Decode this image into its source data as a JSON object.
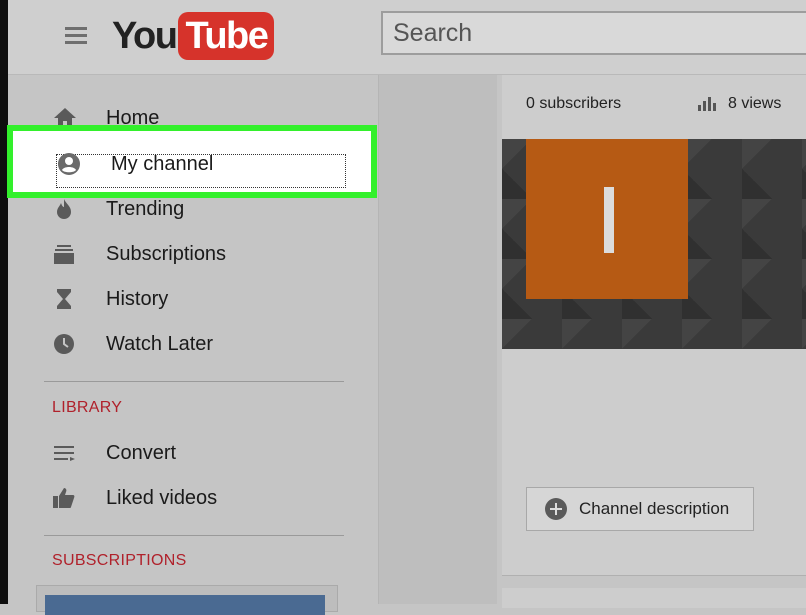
{
  "header": {
    "logo_you": "You",
    "logo_tube": "Tube",
    "search_placeholder": "Search"
  },
  "sidebar": {
    "items": [
      {
        "label": "Home",
        "icon": "home-icon"
      },
      {
        "label": "My channel",
        "icon": "account-icon"
      },
      {
        "label": "Trending",
        "icon": "flame-icon"
      },
      {
        "label": "Subscriptions",
        "icon": "subscriptions-icon"
      },
      {
        "label": "History",
        "icon": "hourglass-icon"
      },
      {
        "label": "Watch Later",
        "icon": "clock-icon"
      }
    ],
    "library_heading": "LIBRARY",
    "library_items": [
      {
        "label": "Convert",
        "icon": "playlist-icon"
      },
      {
        "label": "Liked videos",
        "icon": "thumbs-up-icon"
      }
    ],
    "subscriptions_heading": "SUBSCRIPTIONS"
  },
  "channel": {
    "subscribers": "0 subscribers",
    "views": "8 views",
    "avatar_letter": "I",
    "avatar_color": "#b65a14",
    "description_button": "Channel description"
  },
  "colors": {
    "highlight": "#33f02c",
    "logo_red": "#d6332b",
    "section_red": "#b0212b"
  }
}
